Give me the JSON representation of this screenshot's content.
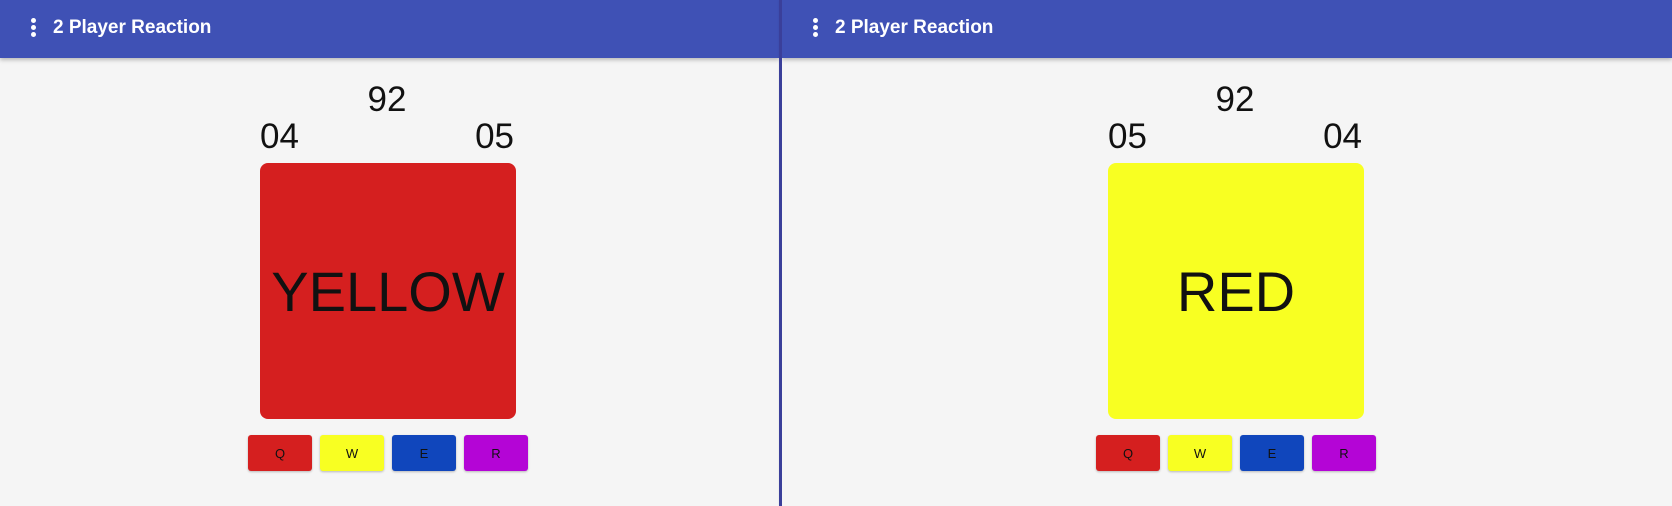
{
  "colors": {
    "appbar": "#3f51b5",
    "red": "#d51f1f",
    "yellow": "#f8ff22",
    "blue": "#1046bc",
    "purple": "#b405d6",
    "background": "#f5f5f5"
  },
  "left_pane": {
    "title": "2 Player Reaction",
    "menu_icon": "more-vert-icon",
    "timer": "92",
    "score_left": "04",
    "score_right": "05",
    "card_word": "YELLOW",
    "card_color": "#d51f1f",
    "buttons": [
      {
        "label": "Q",
        "color": "#d51f1f"
      },
      {
        "label": "W",
        "color": "#f8ff22"
      },
      {
        "label": "E",
        "color": "#1046bc"
      },
      {
        "label": "R",
        "color": "#b405d6"
      }
    ]
  },
  "right_pane": {
    "title": "2 Player Reaction",
    "menu_icon": "more-vert-icon",
    "timer": "92",
    "score_left": "05",
    "score_right": "04",
    "card_word": "RED",
    "card_color": "#f8ff22",
    "buttons": [
      {
        "label": "Q",
        "color": "#d51f1f"
      },
      {
        "label": "W",
        "color": "#f8ff22"
      },
      {
        "label": "E",
        "color": "#1046bc"
      },
      {
        "label": "R",
        "color": "#b405d6"
      }
    ]
  }
}
